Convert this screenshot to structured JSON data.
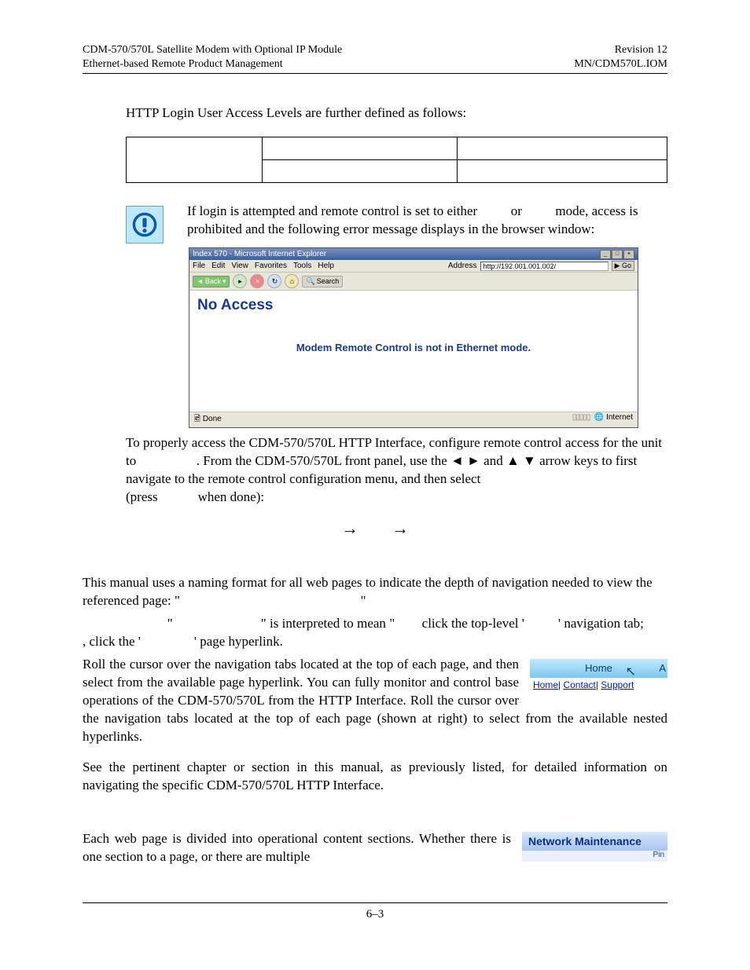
{
  "header": {
    "left1": "CDM-570/570L Satellite Modem with Optional IP Module",
    "left2": "Ethernet-based Remote Product Management",
    "right1": "Revision 12",
    "right2": "MN/CDM570L.IOM"
  },
  "intro": "HTTP Login User Access Levels are further defined as follows:",
  "note": {
    "lead": "If login is attempted and remote control is set to either",
    "or": "or",
    "mode": "mode, access is prohibited and the following error message displays in the browser window:"
  },
  "ie": {
    "title": "Index 570 - Microsoft Internet Explorer",
    "menu": [
      "File",
      "Edit",
      "View",
      "Favorites",
      "Tools",
      "Help"
    ],
    "addressLabel": "Address",
    "url": "http://192.001.001.002/",
    "go": "Go",
    "back": "Back",
    "search": "Search",
    "noAccess": "No Access",
    "modemMsg": "Modem Remote Control is not in Ethernet mode.",
    "done": "Done",
    "internet": "Internet"
  },
  "para1a": "To properly access the CDM-570/570L HTTP Interface, configure remote control access for the unit to",
  "para1b": ". From the CDM-570/570L front panel, use the ◄ ► and ▲ ▼ arrow keys to first navigate to the remote control configuration menu, and then select",
  "para1c": "(press",
  "para1d": "when done):",
  "arrowA": "→",
  "arrowB": "→",
  "naming1": "This manual uses a naming format for all web pages to indicate the depth of navigation needed to view the referenced page: \"",
  "naming1b": "\"",
  "naming2a": "\"",
  "naming2b": "\" is interpreted to mean \"",
  "naming2c": "click the top-level '",
  "naming2d": "' navigation tab;",
  "naming2e": ", click the '",
  "naming2f": "' page hyperlink.",
  "navPara": "Roll the cursor over the navigation tabs located at the top of each page, and then select from the available page hyperlink. You can fully monitor and control base operations of the CDM-570/570L from the HTTP Interface. Roll the cursor over the navigation tabs located at the top of each page (shown at right) to select from the available nested hyperlinks.",
  "seePara": "See the pertinent chapter or section in this manual, as previously listed, for detailed information on navigating the specific CDM-570/570L HTTP Interface.",
  "tabs": {
    "home": "Home",
    "ao": "A",
    "sub1": "Home",
    "sub2": "Contact",
    "sub3": "Support"
  },
  "sectPara": "Each web page is divided into operational content sections. Whether there is one section to a page, or there are multiple",
  "netMaint": "Network Maintenance",
  "ping": "Pin",
  "pageNum": "6–3"
}
